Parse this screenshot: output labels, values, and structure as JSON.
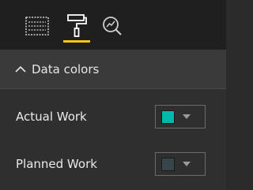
{
  "toolbar": {
    "tools": [
      {
        "icon": "fields-table-icon"
      },
      {
        "icon": "paint-roller-icon",
        "active": true
      },
      {
        "icon": "analytics-magnifier-icon"
      }
    ],
    "accent_color": "#f2c811"
  },
  "section": {
    "title": "Data colors",
    "expanded": true,
    "chevron_icon": "chevron-up-icon"
  },
  "series": [
    {
      "label": "Actual Work",
      "color": "#01b8aa"
    },
    {
      "label": "Planned Work",
      "color": "#374649"
    }
  ]
}
